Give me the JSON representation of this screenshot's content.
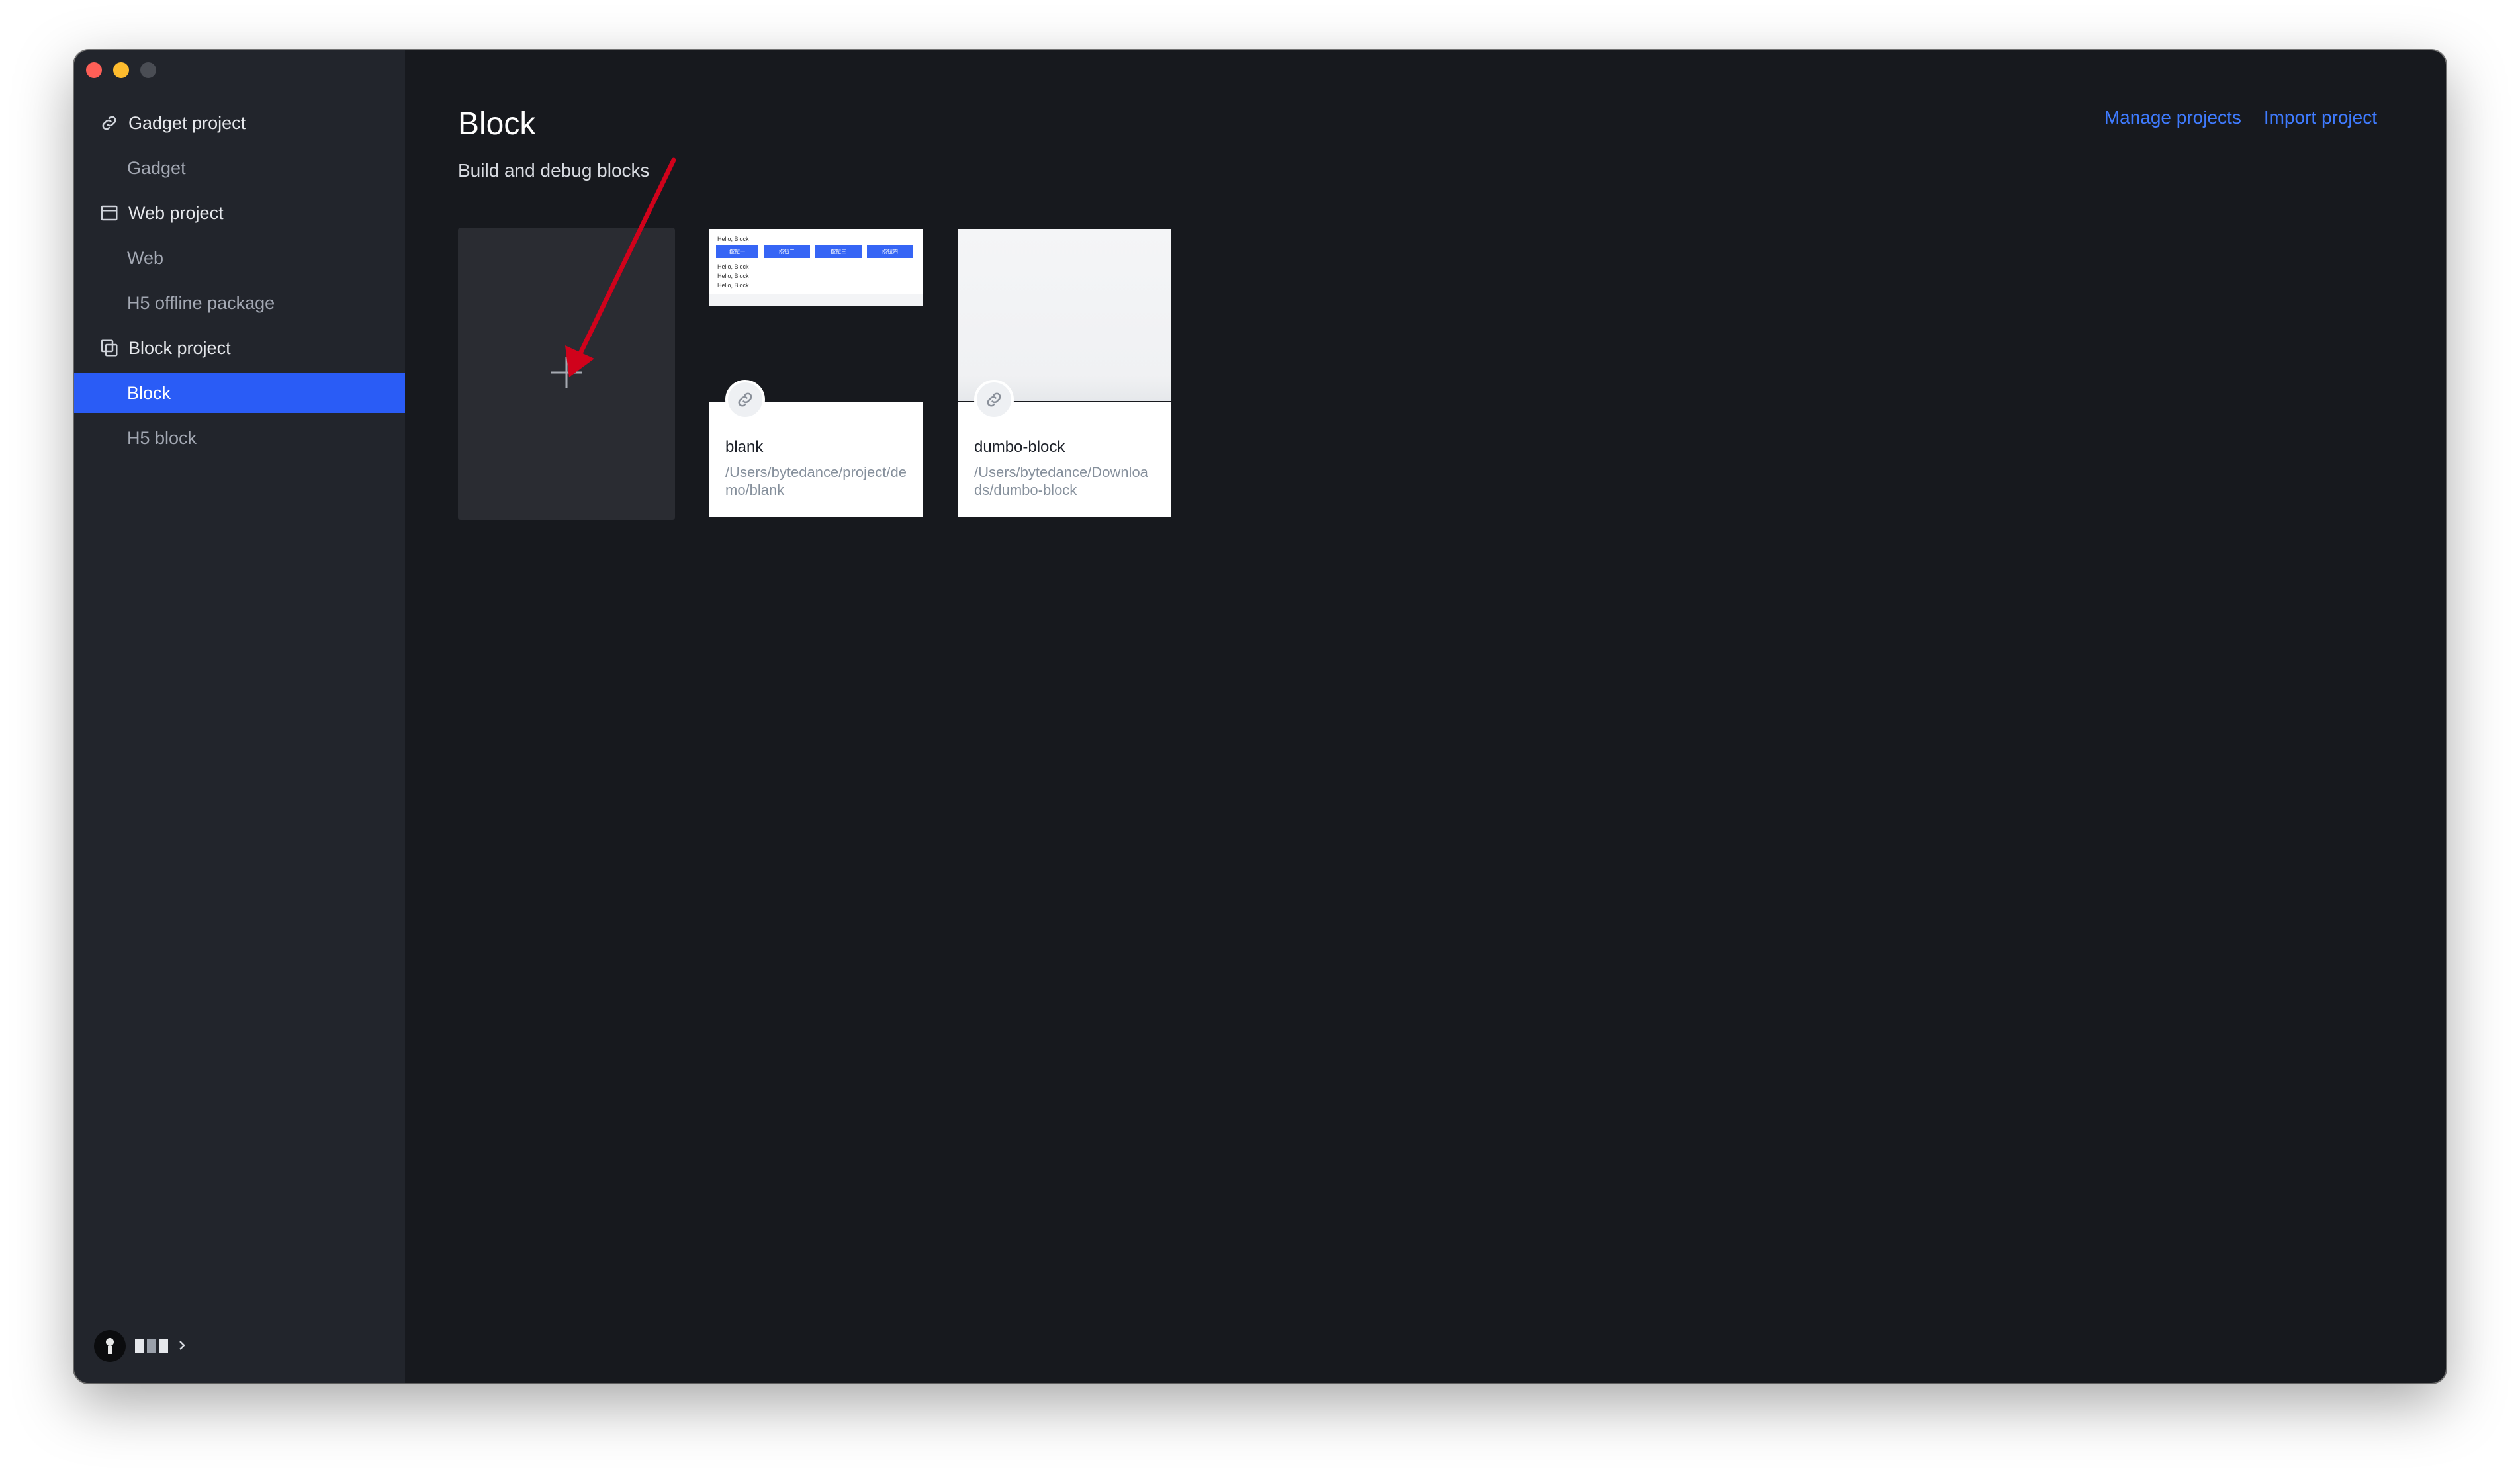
{
  "sidebar": {
    "groups": [
      {
        "label": "Gadget project",
        "icon": "link-icon",
        "items": [
          {
            "label": "Gadget"
          }
        ]
      },
      {
        "label": "Web project",
        "icon": "browser-window-icon",
        "items": [
          {
            "label": "Web"
          },
          {
            "label": "H5 offline package"
          }
        ]
      },
      {
        "label": "Block project",
        "icon": "copy-blocks-icon",
        "items": [
          {
            "label": "Block",
            "active": true
          },
          {
            "label": "H5 block"
          }
        ]
      }
    ],
    "accent_color": "#2a5cf6"
  },
  "header": {
    "title": "Block",
    "subtitle": "Build and debug blocks",
    "links": [
      {
        "label": "Manage projects"
      },
      {
        "label": "Import project"
      }
    ],
    "link_color": "#3f7bff"
  },
  "create_card": {
    "icon": "plus-icon"
  },
  "projects": [
    {
      "name": "blank",
      "path": "/Users/bytedance/project/demo/blank",
      "preview": {
        "lines_top": "Hello, Block",
        "buttons": [
          "按钮一",
          "按钮二",
          "按钮三",
          "按钮四"
        ],
        "lines": [
          "Hello, Block",
          "Hello, Block",
          "Hello, Block"
        ]
      }
    },
    {
      "name": "dumbo-block",
      "path": "/Users/bytedance/Downloads/dumbo-block"
    }
  ],
  "annotation": {
    "arrow_color": "#d0021b"
  }
}
